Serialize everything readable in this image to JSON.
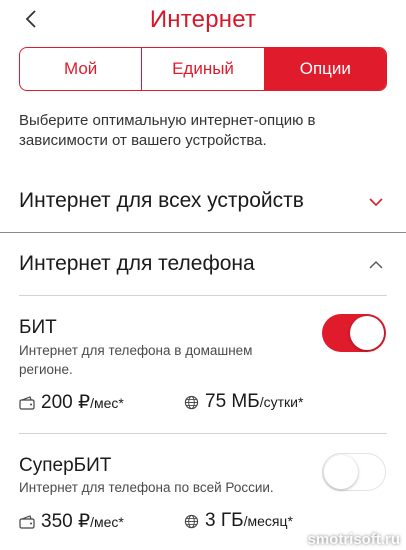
{
  "header": {
    "title": "Интернет"
  },
  "tabs": [
    {
      "label": "Мой",
      "active": false
    },
    {
      "label": "Единый",
      "active": false
    },
    {
      "label": "Опции",
      "active": true
    }
  ],
  "description": "Выберите оптимальную интернет-опцию в зависимости от вашего устройства.",
  "sections": [
    {
      "title": "Интернет для всех устройств",
      "expanded": false
    },
    {
      "title": "Интернет для телефона",
      "expanded": true
    }
  ],
  "options": [
    {
      "name": "БИТ",
      "description": "Интернет для телефона в домашнем регионе.",
      "enabled": true,
      "price": {
        "amount": "200 ₽",
        "unit": "/мес*"
      },
      "traffic": {
        "amount": "75 МБ",
        "unit": "/сутки*"
      }
    },
    {
      "name": "СуперБИТ",
      "description": "Интернет для телефона по всей России.",
      "enabled": false,
      "price": {
        "amount": "350 ₽",
        "unit": "/мес*"
      },
      "traffic": {
        "amount": "3 ГБ",
        "unit": "/месяц*"
      }
    }
  ],
  "watermark": "smotrisoft.ru",
  "colors": {
    "accent": "#e01b2c",
    "title": "#d6182a"
  }
}
